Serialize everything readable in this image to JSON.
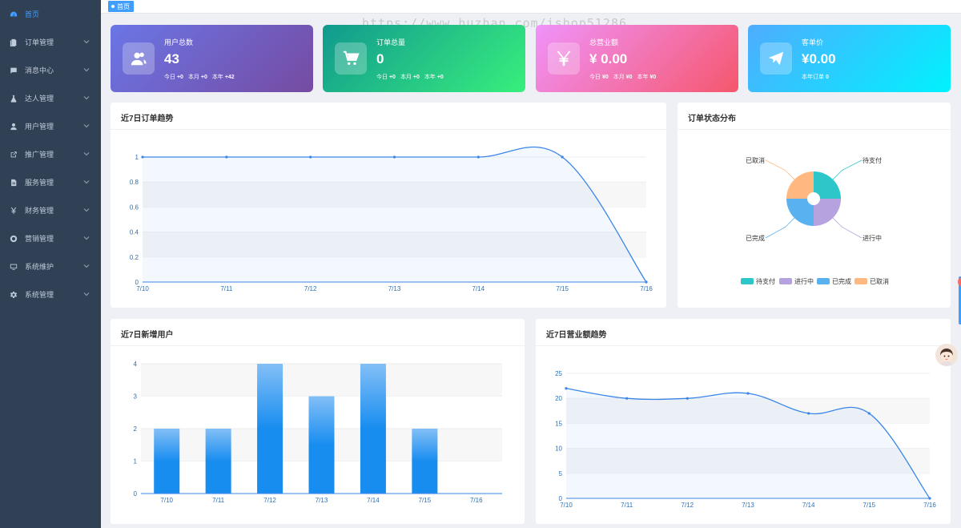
{
  "sidebar": {
    "items": [
      {
        "label": "首页",
        "icon": "dashboard-icon",
        "active": true,
        "has_children": false
      },
      {
        "label": "订单管理",
        "icon": "order-icon",
        "active": false,
        "has_children": true
      },
      {
        "label": "消息中心",
        "icon": "message-icon",
        "active": false,
        "has_children": true
      },
      {
        "label": "达人管理",
        "icon": "flask-icon",
        "active": false,
        "has_children": true
      },
      {
        "label": "用户管理",
        "icon": "user-icon",
        "active": false,
        "has_children": true
      },
      {
        "label": "推广管理",
        "icon": "external-link-icon",
        "active": false,
        "has_children": true
      },
      {
        "label": "服务管理",
        "icon": "file-icon",
        "active": false,
        "has_children": true
      },
      {
        "label": "财务管理",
        "icon": "yen-icon",
        "active": false,
        "has_children": true
      },
      {
        "label": "营销管理",
        "icon": "life-ring-icon",
        "active": false,
        "has_children": true
      },
      {
        "label": "系统维护",
        "icon": "monitor-icon",
        "active": false,
        "has_children": true
      },
      {
        "label": "系统管理",
        "icon": "gear-icon",
        "active": false,
        "has_children": true
      }
    ]
  },
  "tags": {
    "active": "首页"
  },
  "watermark": "https://www.huzhan.com/ishop51286",
  "stats": [
    {
      "title": "用户总数",
      "value": "43",
      "icon": "users-icon",
      "sub": [
        [
          "今日",
          "+0"
        ],
        [
          "本月",
          "+0"
        ],
        [
          "本年",
          "+42"
        ]
      ]
    },
    {
      "title": "订单总量",
      "value": "0",
      "icon": "cart-icon",
      "sub": [
        [
          "今日",
          "+0"
        ],
        [
          "本月",
          "+0"
        ],
        [
          "本年",
          "+0"
        ]
      ]
    },
    {
      "title": "总营业额",
      "value": "¥ 0.00",
      "icon": "yen-icon",
      "sub": [
        [
          "今日",
          "¥0"
        ],
        [
          "本月",
          "¥0"
        ],
        [
          "本年",
          "¥0"
        ]
      ]
    },
    {
      "title": "客单价",
      "value": "¥0.00",
      "icon": "paper-plane-icon",
      "sub": [
        [
          "本年订单",
          "0"
        ]
      ]
    }
  ],
  "panels": {
    "orders_trend": "近7日订单趋势",
    "order_status": "订单状态分布",
    "new_users": "近7日新增用户",
    "revenue_trend": "近7日营业额趋势"
  },
  "colors": {
    "accent": "#409eff",
    "line": "#3a86e8",
    "pie": [
      "#2ec7c9",
      "#b6a2de",
      "#5ab1ef",
      "#ffb980"
    ]
  },
  "chart_data": [
    {
      "type": "line",
      "title": "近7日订单趋势",
      "x": [
        "7/10",
        "7/11",
        "7/12",
        "7/13",
        "7/14",
        "7/15",
        "7/16"
      ],
      "values": [
        1,
        1,
        1,
        1,
        1,
        1,
        0
      ],
      "ylim": [
        0,
        1
      ],
      "yticks": [
        "0",
        "0.2",
        "0.4",
        "0.6",
        "0.8",
        "1"
      ],
      "smooth": true,
      "area": true
    },
    {
      "type": "pie",
      "title": "订单状态分布",
      "donut": true,
      "legend_position": "bottom",
      "slices": [
        {
          "name": "待支付",
          "value": 1
        },
        {
          "name": "进行中",
          "value": 1
        },
        {
          "name": "已完成",
          "value": 1
        },
        {
          "name": "已取消",
          "value": 1
        }
      ]
    },
    {
      "type": "bar",
      "title": "近7日新增用户",
      "categories": [
        "7/10",
        "7/11",
        "7/12",
        "7/13",
        "7/14",
        "7/15",
        "7/16"
      ],
      "values": [
        2,
        2,
        4,
        3,
        4,
        2,
        0
      ],
      "ylim": [
        0,
        4
      ],
      "yticks": [
        "0",
        "1",
        "2",
        "3",
        "4"
      ]
    },
    {
      "type": "line",
      "title": "近7日营业额趋势",
      "x": [
        "7/10",
        "7/11",
        "7/12",
        "7/13",
        "7/14",
        "7/15",
        "7/16"
      ],
      "values": [
        22,
        20,
        20,
        21,
        17,
        17,
        0
      ],
      "ylim": [
        0,
        25
      ],
      "yticks": [
        "0",
        "5",
        "10",
        "15",
        "20",
        "25"
      ],
      "smooth": true,
      "area": true
    }
  ]
}
